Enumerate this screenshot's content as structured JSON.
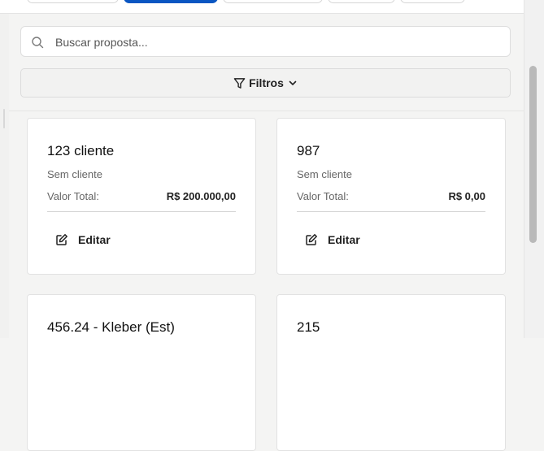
{
  "search": {
    "placeholder": "Buscar proposta..."
  },
  "filters": {
    "label": "Filtros"
  },
  "cards": [
    {
      "title": "123 cliente",
      "client": "Sem cliente",
      "total_label": "Valor Total:",
      "total_value": "R$ 200.000,00",
      "edit_label": "Editar"
    },
    {
      "title": "987",
      "client": "Sem cliente",
      "total_label": "Valor Total:",
      "total_value": "R$ 0,00",
      "edit_label": "Editar"
    },
    {
      "title": "456.24 - Kleber (Est)"
    },
    {
      "title": "215"
    }
  ],
  "icons": {
    "search": "search-icon",
    "filter": "filter-icon",
    "chevron": "chevron-down-icon",
    "edit": "edit-icon"
  },
  "colors": {
    "active_tab": "#0a56c2",
    "card_bg": "#ffffff",
    "page_bg": "#f4f4f3",
    "divider": "#d2d2d2"
  }
}
